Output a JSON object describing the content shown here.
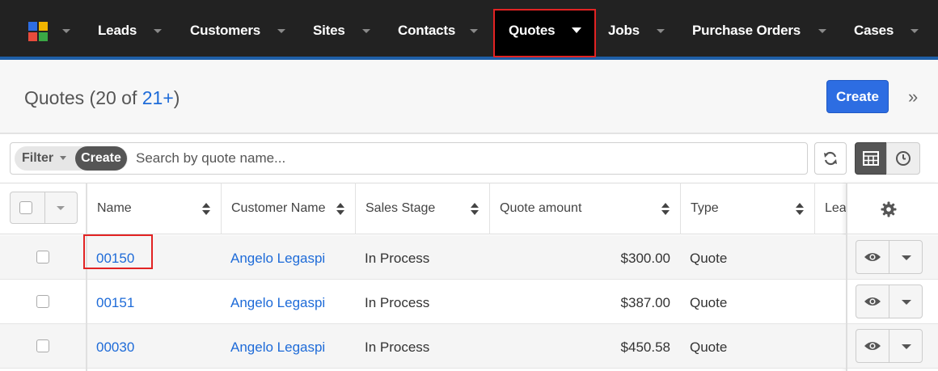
{
  "nav": {
    "items": [
      {
        "label": "Leads"
      },
      {
        "label": "Customers"
      },
      {
        "label": "Sites"
      },
      {
        "label": "Contacts"
      },
      {
        "label": "Quotes",
        "active": true
      },
      {
        "label": "Jobs"
      },
      {
        "label": "Purchase Orders"
      },
      {
        "label": "Cases"
      }
    ]
  },
  "header": {
    "title": "Quotes",
    "count_open": "(20 of ",
    "count_link": "21+",
    "count_close": ")",
    "create_label": "Create"
  },
  "filter": {
    "label": "Filter",
    "create_label": "Create",
    "search_placeholder": "Search by quote name..."
  },
  "table": {
    "columns": [
      "Name",
      "Customer Name",
      "Sales Stage",
      "Quote amount",
      "Type",
      "Lea"
    ],
    "rows": [
      {
        "name": "00150",
        "customer": "Angelo Legaspi",
        "stage": "In Process",
        "amount": "$300.00",
        "type": "Quote"
      },
      {
        "name": "00151",
        "customer": "Angelo Legaspi",
        "stage": "In Process",
        "amount": "$387.00",
        "type": "Quote"
      },
      {
        "name": "00030",
        "customer": "Angelo Legaspi",
        "stage": "In Process",
        "amount": "$450.58",
        "type": "Quote"
      }
    ]
  },
  "colors": {
    "nav_bg": "#222222",
    "accent_blue": "#2d6de2",
    "link_blue": "#1e6bd8",
    "highlight_red": "#e22323"
  }
}
